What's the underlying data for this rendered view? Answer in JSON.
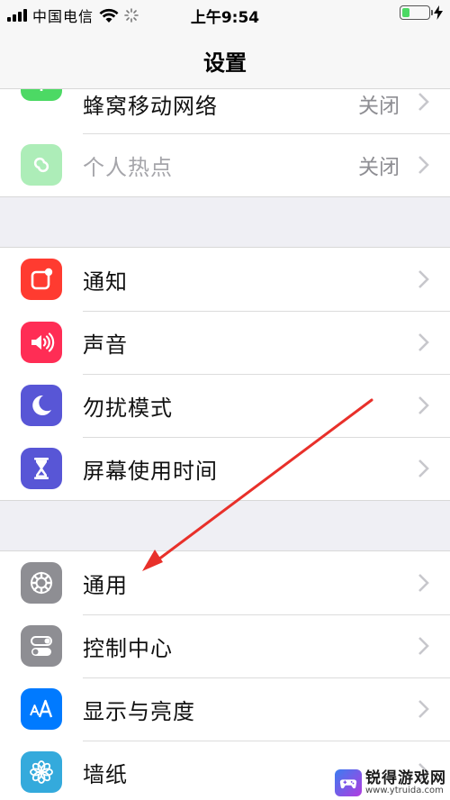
{
  "status_bar": {
    "carrier": "中国电信",
    "time": "上午9:54",
    "battery_level": 0.3
  },
  "nav": {
    "title": "设置"
  },
  "groups": [
    {
      "rows": [
        {
          "label": "蜂窝移动网络",
          "value": "关闭",
          "icon": "cellular-antenna-icon",
          "icon_color": "#4cd964",
          "dimmed": false,
          "partial": true
        },
        {
          "label": "个人热点",
          "value": "关闭",
          "icon": "hotspot-link-icon",
          "icon_color": "#4cd964",
          "dimmed": true,
          "partial": false
        }
      ]
    },
    {
      "rows": [
        {
          "label": "通知",
          "value": "",
          "icon": "notification-icon",
          "icon_color": "#ff3b30"
        },
        {
          "label": "声音",
          "value": "",
          "icon": "speaker-icon",
          "icon_color": "#ff2d55"
        },
        {
          "label": "勿扰模式",
          "value": "",
          "icon": "moon-icon",
          "icon_color": "#5856d6"
        },
        {
          "label": "屏幕使用时间",
          "value": "",
          "icon": "hourglass-icon",
          "icon_color": "#5856d6"
        }
      ]
    },
    {
      "rows": [
        {
          "label": "通用",
          "value": "",
          "icon": "gear-icon",
          "icon_color": "#8e8e93"
        },
        {
          "label": "控制中心",
          "value": "",
          "icon": "toggle-switches-icon",
          "icon_color": "#8e8e93"
        },
        {
          "label": "显示与亮度",
          "value": "",
          "icon": "text-size-icon",
          "icon_color": "#007aff"
        },
        {
          "label": "墙纸",
          "value": "",
          "icon": "flower-icon",
          "icon_color": "#34aadc"
        }
      ]
    }
  ],
  "watermark": {
    "name": "锐得游戏网",
    "url": "www.ytruida.com"
  }
}
